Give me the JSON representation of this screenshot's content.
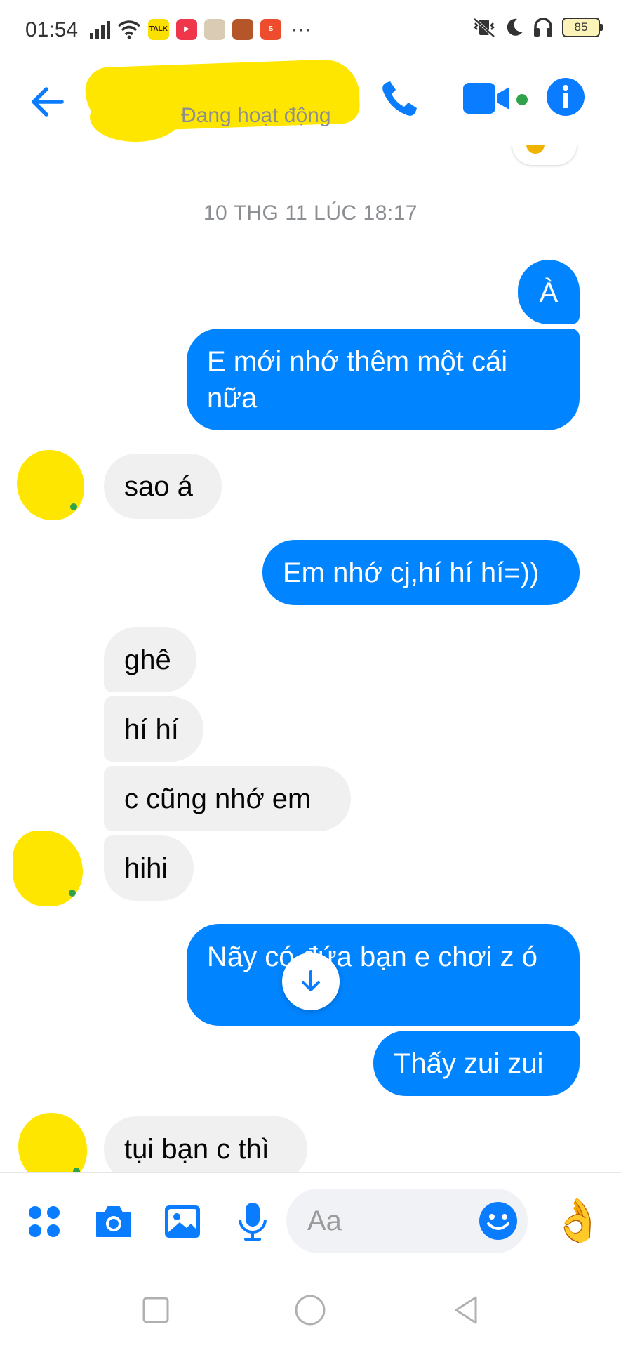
{
  "status_bar": {
    "time": "01:54",
    "battery": "85"
  },
  "header": {
    "contact_status": "Đang hoạt động"
  },
  "conversation": {
    "timestamp": "10 THG 11 LÚC 18:17",
    "messages": [
      {
        "dir": "out",
        "text": "À"
      },
      {
        "dir": "out",
        "text": "E mới nhớ thêm một cái nữa"
      },
      {
        "dir": "in",
        "text": "sao á"
      },
      {
        "dir": "out",
        "text": "Em nhớ cj,hí hí hí=))"
      },
      {
        "dir": "in",
        "text": "ghê"
      },
      {
        "dir": "in",
        "text": "hí hí"
      },
      {
        "dir": "in",
        "text": "c cũng nhớ em"
      },
      {
        "dir": "in",
        "text": "hihi"
      },
      {
        "dir": "out",
        "text": "Nãy có đứa bạn e chơi z ó"
      },
      {
        "dir": "out",
        "text": "Thấy zui zui"
      },
      {
        "dir": "in",
        "text": "tụi bạn c thì"
      }
    ]
  },
  "composer": {
    "placeholder": "Aa"
  },
  "colors": {
    "accent": "#0084ff",
    "incoming_bubble": "#f0f0f0",
    "online": "#31a24c",
    "redaction": "#ffe600"
  },
  "icons": [
    "back-arrow-icon",
    "phone-icon",
    "video-camera-icon",
    "info-icon",
    "apps-icon",
    "camera-icon",
    "image-icon",
    "microphone-icon",
    "emoji-icon",
    "ok-hand-icon",
    "arrow-down-icon"
  ]
}
